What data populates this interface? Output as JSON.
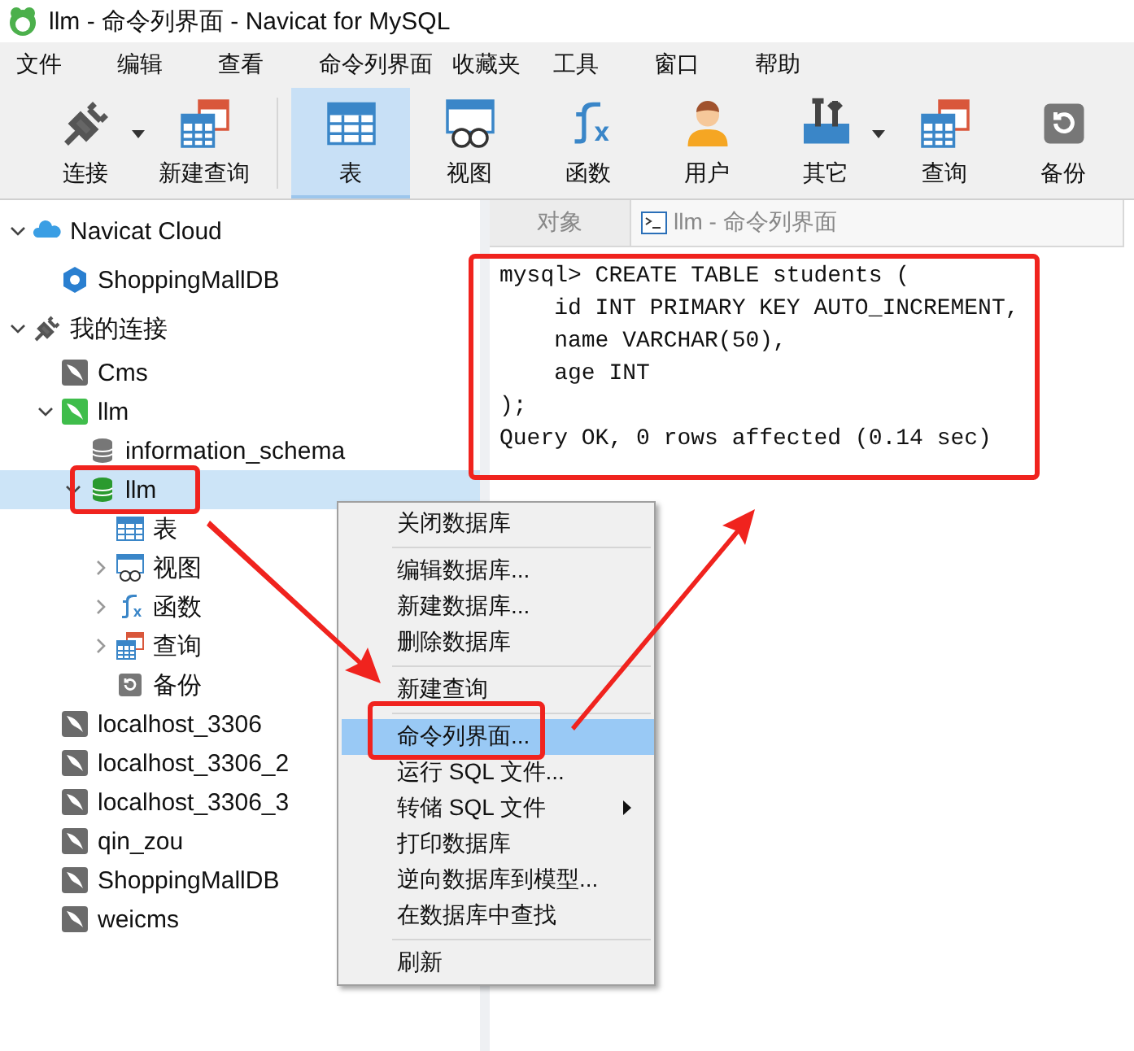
{
  "window": {
    "title": "llm - 命令列界面 - Navicat for MySQL"
  },
  "menu_bar": [
    "文件",
    "编辑",
    "查看",
    "命令列界面",
    "收藏夹",
    "工具",
    "窗口",
    "帮助"
  ],
  "toolbar": [
    {
      "label": "连接",
      "kind": "connect",
      "dropdown": true,
      "selected": false
    },
    {
      "label": "新建查询",
      "kind": "new-query",
      "dropdown": false,
      "selected": false
    },
    {
      "label": "表",
      "kind": "table",
      "dropdown": false,
      "selected": true
    },
    {
      "label": "视图",
      "kind": "view",
      "dropdown": false,
      "selected": false
    },
    {
      "label": "函数",
      "kind": "function",
      "dropdown": false,
      "selected": false
    },
    {
      "label": "用户",
      "kind": "user",
      "dropdown": false,
      "selected": false
    },
    {
      "label": "其它",
      "kind": "tools",
      "dropdown": true,
      "selected": false
    },
    {
      "label": "查询",
      "kind": "query",
      "dropdown": false,
      "selected": false
    },
    {
      "label": "备份",
      "kind": "backup",
      "dropdown": false,
      "selected": false
    }
  ],
  "tree": [
    {
      "label": "Navicat Cloud",
      "kind": "cloud",
      "expanded": true,
      "selected": false,
      "children": [
        {
          "label": "ShoppingMallDB",
          "kind": "cloud-db",
          "selected": false
        }
      ]
    },
    {
      "label": "我的连接",
      "kind": "plug",
      "expanded": true,
      "selected": false,
      "children": [
        {
          "label": "Cms",
          "kind": "conn",
          "selected": false
        },
        {
          "label": "llm",
          "kind": "conn-open",
          "expanded": true,
          "selected": false,
          "children": [
            {
              "label": "information_schema",
              "kind": "db",
              "selected": false
            },
            {
              "label": "llm",
              "kind": "db-open",
              "expanded": true,
              "selected": true,
              "children": [
                {
                  "label": "表",
                  "kind": "table",
                  "selected": false
                },
                {
                  "label": "视图",
                  "kind": "view",
                  "expanded": false,
                  "selected": false
                },
                {
                  "label": "函数",
                  "kind": "function",
                  "expanded": false,
                  "selected": false
                },
                {
                  "label": "查询",
                  "kind": "query",
                  "expanded": false,
                  "selected": false
                },
                {
                  "label": "备份",
                  "kind": "backup",
                  "selected": false
                }
              ]
            }
          ]
        },
        {
          "label": "localhost_3306",
          "kind": "conn",
          "selected": false
        },
        {
          "label": "localhost_3306_2",
          "kind": "conn",
          "selected": false
        },
        {
          "label": "localhost_3306_3",
          "kind": "conn",
          "selected": false
        },
        {
          "label": "qin_zou",
          "kind": "conn",
          "selected": false
        },
        {
          "label": "ShoppingMallDB",
          "kind": "conn",
          "selected": false
        },
        {
          "label": "weicms",
          "kind": "conn",
          "selected": false
        }
      ]
    }
  ],
  "tabs": [
    {
      "label": "对象",
      "kind": "plain",
      "selected": false
    },
    {
      "label": "llm - 命令列界面",
      "kind": "console",
      "selected": true
    }
  ],
  "console": [
    "mysql> CREATE TABLE students (",
    "    id INT PRIMARY KEY AUTO_INCREMENT,",
    "    name VARCHAR(50),",
    "    age INT",
    ");",
    "Query OK, 0 rows affected (0.14 sec)"
  ],
  "context_menu": [
    [
      {
        "label": "关闭数据库",
        "selected": false
      }
    ],
    [
      {
        "label": "编辑数据库...",
        "selected": false
      },
      {
        "label": "新建数据库...",
        "selected": false
      },
      {
        "label": "删除数据库",
        "selected": false
      }
    ],
    [
      {
        "label": "新建查询",
        "selected": false
      }
    ],
    [
      {
        "label": "命令列界面...",
        "selected": true
      },
      {
        "label": "运行 SQL 文件...",
        "selected": false
      },
      {
        "label": "转储 SQL 文件",
        "selected": false,
        "submenu": true
      },
      {
        "label": "打印数据库",
        "selected": false
      },
      {
        "label": "逆向数据库到模型...",
        "selected": false
      },
      {
        "label": "在数据库中查找",
        "selected": false
      }
    ],
    [
      {
        "label": "刷新",
        "selected": false
      }
    ]
  ]
}
